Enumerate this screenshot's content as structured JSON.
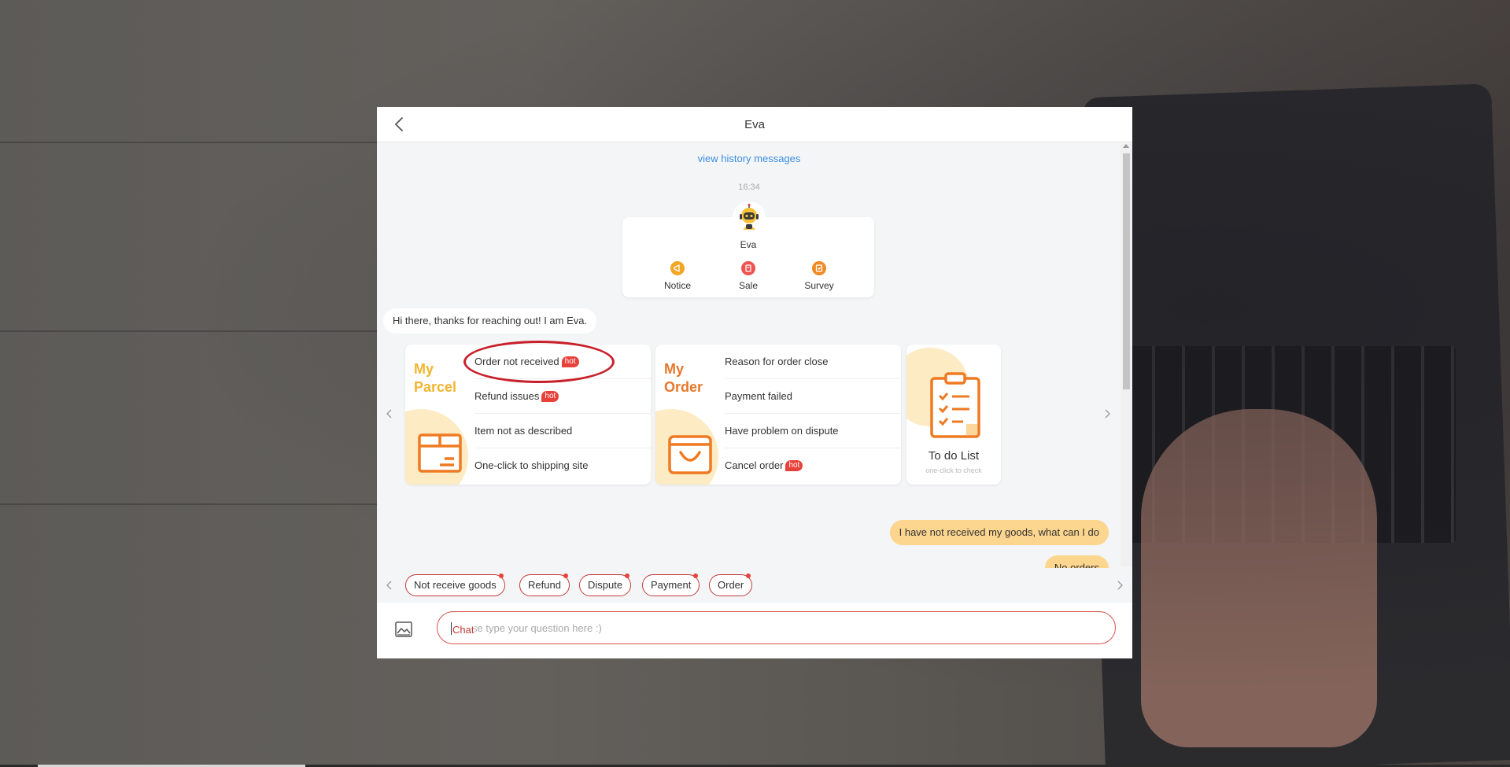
{
  "header": {
    "title": "Eva"
  },
  "history_link": "view history messages",
  "timestamp": "16:34",
  "profile": {
    "name": "Eva",
    "actions": [
      {
        "label": "Notice",
        "icon": "notice-icon",
        "color": "#f2a623"
      },
      {
        "label": "Sale",
        "icon": "sale-icon",
        "color": "#ef5350"
      },
      {
        "label": "Survey",
        "icon": "survey-icon",
        "color": "#f08a24"
      }
    ]
  },
  "greeting": "Hi there, thanks for reaching out! I am Eva.",
  "cards": [
    {
      "title_line1": "My",
      "title_line2": "Parcel",
      "title_color": "#f2b530",
      "items": [
        {
          "label": "Order not received",
          "hot": "hot"
        },
        {
          "label": "Refund issues",
          "hot": "hot"
        },
        {
          "label": "Item not as described",
          "hot": ""
        },
        {
          "label": "One-click to shipping site",
          "hot": ""
        }
      ]
    },
    {
      "title_line1": "My",
      "title_line2": "Order",
      "title_color": "#e8782a",
      "items": [
        {
          "label": "Reason for order close",
          "hot": ""
        },
        {
          "label": "Payment failed",
          "hot": ""
        },
        {
          "label": "Have problem on dispute",
          "hot": ""
        },
        {
          "label": "Cancel order",
          "hot": "hot"
        }
      ]
    }
  ],
  "todo": {
    "title": "To do List",
    "subtitle": "one-click to check"
  },
  "user_messages": [
    "I have not received my goods, what can I do",
    "No orders"
  ],
  "quick_chips": [
    "Not receive goods",
    "Refund",
    "Dispute",
    "Payment",
    "Order"
  ],
  "input": {
    "typed": "Chat",
    "placeholder": "Please type your question here :)"
  },
  "colors": {
    "accent_red": "#c23b3b",
    "user_bubble": "#fcd58e",
    "link_blue": "#3a8ee6",
    "brand_orange": "#e8782a"
  }
}
